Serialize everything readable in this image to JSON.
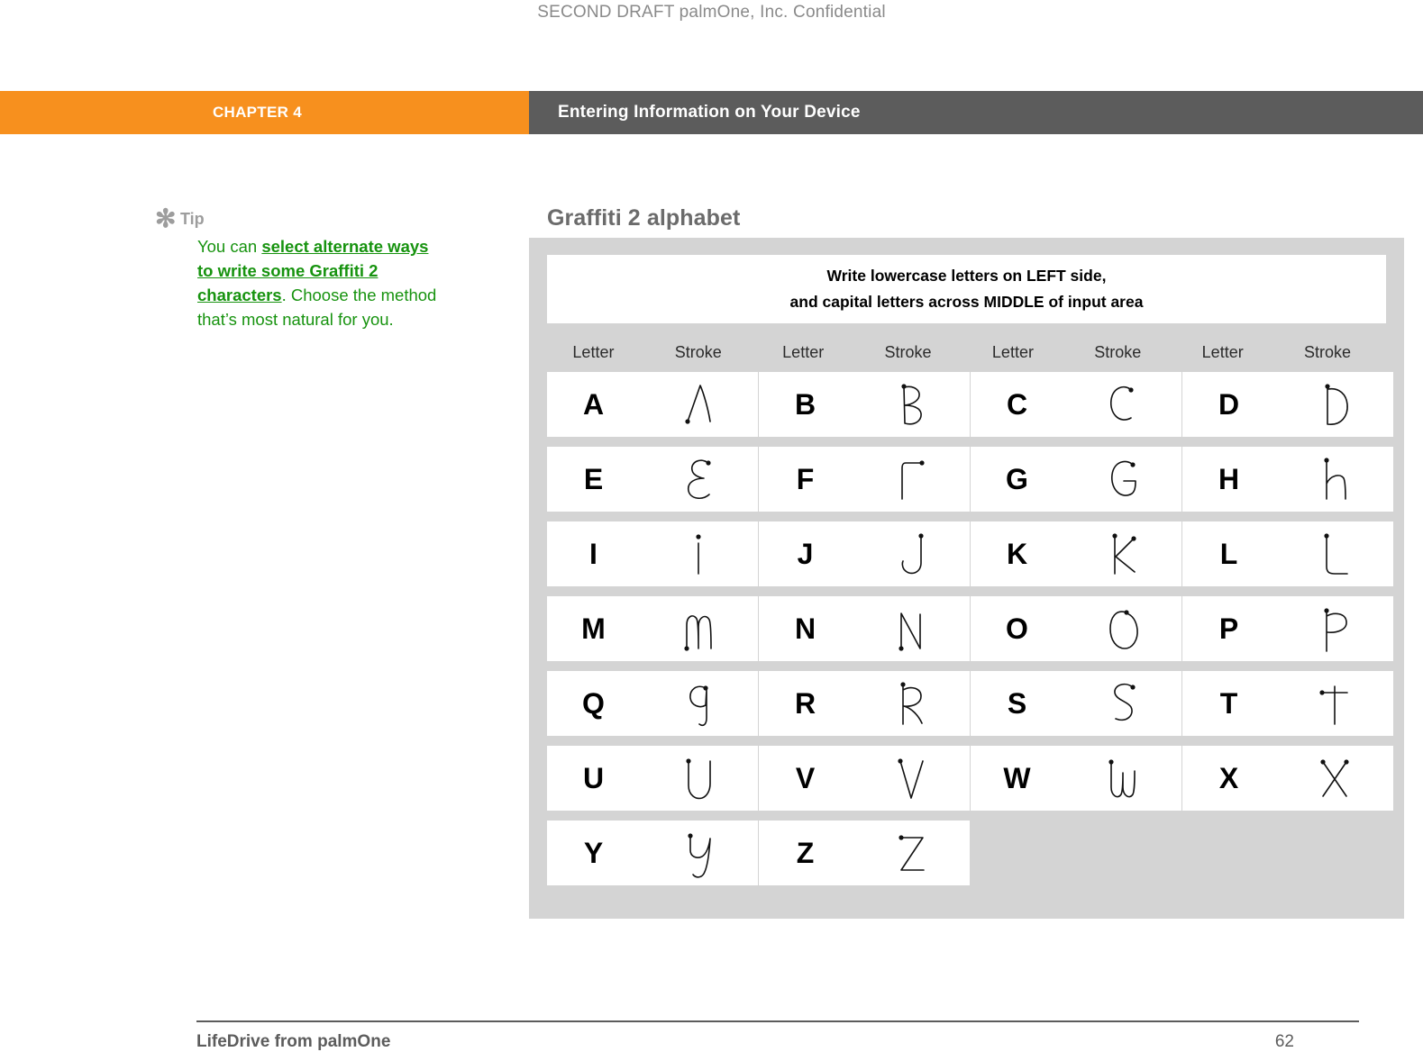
{
  "draft_stamp": "SECOND DRAFT palmOne, Inc.  Confidential",
  "header": {
    "chapter": "CHAPTER 4",
    "title": "Entering Information on Your Device",
    "chapter_bg": "#F7901E",
    "title_bg": "#5C5C5C"
  },
  "tip": {
    "icon": "asterisk-icon",
    "asterisk": "✻",
    "label": "Tip",
    "text_before": "You can ",
    "link": "select alternate ways to write some Graffiti 2 characters",
    "text_after": ". Choose the method that’s most natural for you.",
    "link_color": "#17930F"
  },
  "main": {
    "section_title": "Graffiti 2 alphabet",
    "banner_line1": "Write lowercase letters on LEFT side,",
    "banner_line2": "and capital letters across MIDDLE of input area",
    "column_headers": [
      "Letter",
      "Stroke",
      "Letter",
      "Stroke",
      "Letter",
      "Stroke",
      "Letter",
      "Stroke"
    ],
    "rows": [
      [
        "A",
        "B",
        "C",
        "D"
      ],
      [
        "E",
        "F",
        "G",
        "H"
      ],
      [
        "I",
        "J",
        "K",
        "L"
      ],
      [
        "M",
        "N",
        "O",
        "P"
      ],
      [
        "Q",
        "R",
        "S",
        "T"
      ],
      [
        "U",
        "V",
        "W",
        "X"
      ],
      [
        "Y",
        "Z"
      ]
    ]
  },
  "footer": {
    "product": "LifeDrive from palmOne",
    "page_number": "62"
  }
}
